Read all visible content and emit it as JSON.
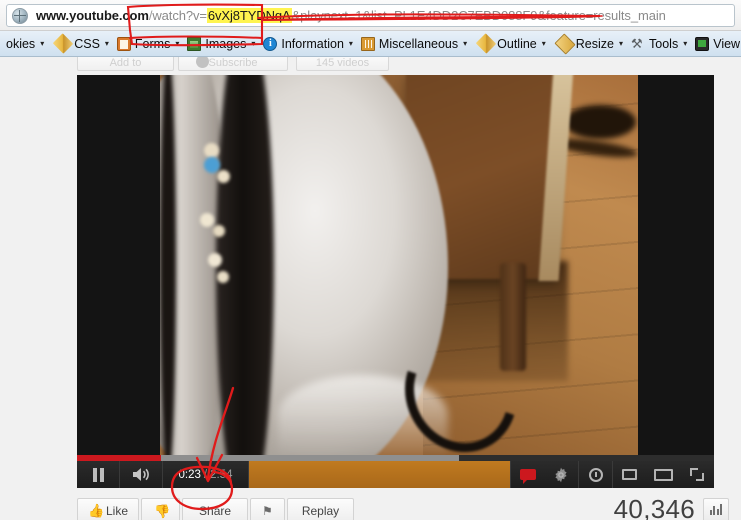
{
  "browser": {
    "address_icon": "globe-icon",
    "url": {
      "domain": "www.youtube.com",
      "slash": "/",
      "path": "watch?v=",
      "video_id": "6vXj8TYDNqA",
      "rest": "&playnext=1&list=PL1E4DD2C7EBD088F9&feature=results_main",
      "full": "www.youtube.com/watch?v=6vXj8TYDNqA&playnext=1&list=PL1E4DD2C7EBD088F9&feature=results_main"
    }
  },
  "devtoolbar": {
    "items": [
      {
        "label": "okies",
        "icon": "cookie-icon",
        "caret": "▾"
      },
      {
        "label": "CSS",
        "icon": "pencil-icon",
        "caret": "▾"
      },
      {
        "label": "Forms",
        "icon": "clipboard-icon",
        "caret": "▾"
      },
      {
        "label": "Images",
        "icon": "image-icon",
        "caret": "▾"
      },
      {
        "label": "Information",
        "icon": "info-icon",
        "caret": "▾"
      },
      {
        "label": "Miscellaneous",
        "icon": "book-icon",
        "caret": "▾"
      },
      {
        "label": "Outline",
        "icon": "pencil-icon",
        "caret": "▾"
      },
      {
        "label": "Resize",
        "icon": "ruler-icon",
        "caret": "▾"
      },
      {
        "label": "Tools",
        "icon": "tools-icon",
        "caret": "▾"
      },
      {
        "label": "View Source",
        "icon": "monitor-icon",
        "caret": "▾"
      },
      {
        "label": "",
        "icon": "side-panel-icon",
        "caret": ""
      }
    ]
  },
  "page": {
    "ghost_buttons": [
      {
        "label": "Add to"
      },
      {
        "label": "Subscribe"
      },
      {
        "label": "145 videos"
      }
    ]
  },
  "player": {
    "pause_icon": "pause-icon",
    "volume_icon": "volume-icon",
    "time_current": "0:23",
    "time_separator": "/",
    "time_total": "2:54",
    "progress_played_percent": 13,
    "progress_buffered_percent": 60,
    "right_controls": [
      {
        "name": "captions-icon"
      },
      {
        "name": "settings-gear-icon"
      },
      {
        "name": "watch-later-clock-icon"
      },
      {
        "name": "small-player-icon"
      },
      {
        "name": "theater-mode-icon"
      },
      {
        "name": "fullscreen-icon"
      }
    ]
  },
  "actions": {
    "like_label": "Like",
    "like_icon": "thumbs-up-icon",
    "dislike_icon": "thumbs-down-icon",
    "share_label": "Share",
    "flag_icon": "flag-icon",
    "replay_label": "Replay"
  },
  "stats": {
    "view_count": "40,346",
    "stats_icon": "bar-chart-icon"
  },
  "annotations": {
    "color": "#e01b1b",
    "highlight_color": "#fff44f",
    "marks": [
      {
        "name": "url-video-id-box",
        "shape": "rectangle"
      },
      {
        "name": "url-strikethrough",
        "shape": "line"
      },
      {
        "name": "share-button-circle",
        "shape": "ellipse"
      },
      {
        "name": "share-pointer-arrow",
        "shape": "arrow"
      }
    ]
  }
}
